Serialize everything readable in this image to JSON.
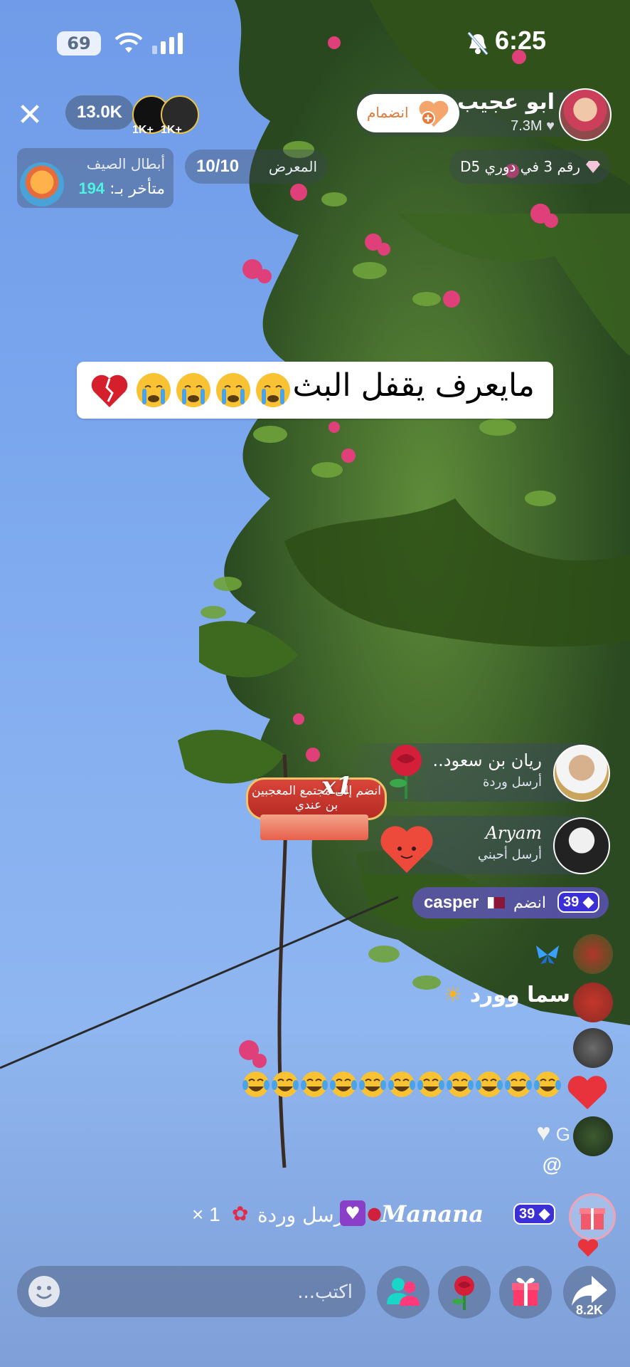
{
  "status_bar": {
    "battery": "69",
    "time": "6:25"
  },
  "header": {
    "viewers": "13.0K",
    "top_viewers": [
      {
        "badge": "1K+"
      },
      {
        "badge": "1K+"
      }
    ],
    "host": {
      "name": "ابو عجيب",
      "likes": "7.3M",
      "join_label": "انضمام"
    }
  },
  "info_row": {
    "event_title": "أبطال الصيف",
    "late_label": "متأخر بـ:",
    "late_value": "194",
    "gallery_score": "10/10",
    "gallery_label": "المعرض",
    "league_text": "رقم 3 في دوري D5"
  },
  "banner": {
    "text": "مايعرف يقفل البث"
  },
  "gifts": [
    {
      "name": "ريان بن سعود..",
      "action": "أرسل وردة"
    },
    {
      "name": "Aryam",
      "action": "أرسل أحبني"
    }
  ],
  "community_tag": {
    "line1": "انضم إلى مجتمع المعجبين",
    "line2": "بن عندي",
    "multiplier": "x1"
  },
  "chat": {
    "join_message": {
      "level": "39",
      "name": "casper",
      "text": "انضم"
    },
    "messages": [
      {
        "text": "سما وورد"
      },
      {
        "text": "G"
      },
      {
        "text": "@"
      }
    ],
    "gift_message": {
      "level": "39",
      "name": "Manana",
      "text": "أرسل وردة",
      "count": "× 1"
    }
  },
  "bottom_bar": {
    "comment_placeholder": "اكتب...",
    "share_count": "8.2K"
  }
}
